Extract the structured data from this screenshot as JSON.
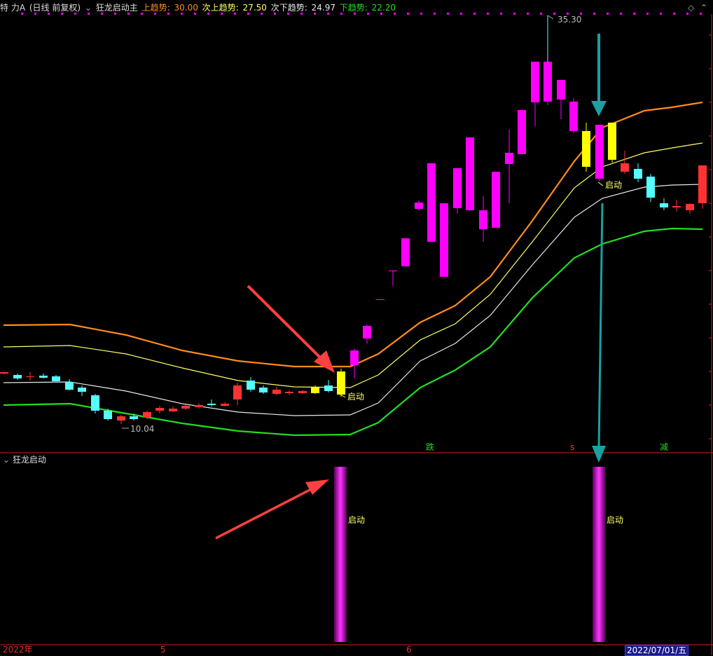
{
  "header": {
    "stock_name": "特 力A",
    "period_info": "(日线 前复权)",
    "indicator_name": "狂龙启动主",
    "upper_trend_label": "上趋势:",
    "upper_trend_value": "30.00",
    "next_upper_label": "次上趋势:",
    "next_upper_value": "27.50",
    "next_lower_label": "次下趋势:",
    "next_lower_value": "24.97",
    "lower_trend_label": "下趋势:",
    "lower_trend_value": "22.20"
  },
  "colors": {
    "upper_trend": "#ff8c1a",
    "next_upper_trend": "#ffff66",
    "next_lower_trend": "#e8e8e8",
    "lower_trend": "#22dd22",
    "candle_up": "#ff3333",
    "candle_down": "#55ffff",
    "candle_magenta": "#ff00ff",
    "candle_yellow": "#ffff00",
    "grid_red": "#cc2222",
    "annotation_red": "#ff4040",
    "annotation_teal": "#1aa0a0"
  },
  "main_chart": {
    "high_label": "35.30",
    "low_label": "10.04",
    "signal_label_1": "启动",
    "signal_label_2": "启动",
    "marker_die": "跌",
    "marker_s": "s",
    "marker_jian": "减"
  },
  "indicator_panel": {
    "title": "狂龙启动",
    "bar_label_1": "启动",
    "bar_label_2": "启动"
  },
  "x_axis": {
    "label_year": "2022年",
    "label_may": "5",
    "label_june": "6",
    "current_date": "2022/07/01/五"
  },
  "chart_data": {
    "type": "candlestick",
    "series": [
      {
        "name": "上趋势",
        "values": [
          30.0
        ]
      },
      {
        "name": "次上趋势",
        "values": [
          27.5
        ]
      },
      {
        "name": "次下趋势",
        "values": [
          24.97
        ]
      },
      {
        "name": "下趋势",
        "values": [
          22.2
        ]
      }
    ],
    "marked_high": 35.3,
    "marked_low": 10.04
  }
}
